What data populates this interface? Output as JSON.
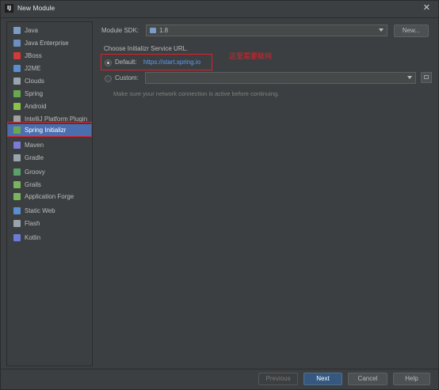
{
  "window": {
    "title": "New Module",
    "close_glyph": "✕"
  },
  "sidebar": {
    "items": [
      {
        "label": "Java",
        "icon": "folder-icon",
        "color": "#7a9cc6"
      },
      {
        "label": "Java Enterprise",
        "icon": "java-ee-icon",
        "color": "#6a8fc0"
      },
      {
        "label": "JBoss",
        "icon": "jboss-icon",
        "color": "#d33a3a"
      },
      {
        "label": "J2ME",
        "icon": "j2me-icon",
        "color": "#5a8ed0"
      },
      {
        "label": "Clouds",
        "icon": "clouds-icon",
        "color": "#9aa4ad"
      },
      {
        "label": "Spring",
        "icon": "spring-icon",
        "color": "#6aa84f"
      },
      {
        "label": "Android",
        "icon": "android-icon",
        "color": "#8bc34a"
      },
      {
        "label": "IntelliJ Platform Plugin",
        "icon": "plugin-icon",
        "color": "#a0a0a0"
      },
      {
        "label": "Spring Initializr",
        "icon": "spring-initializr-icon",
        "color": "#6aa84f",
        "selected": true
      },
      {
        "label": "Maven",
        "icon": "maven-icon",
        "color": "#7c7cd6"
      },
      {
        "label": "Gradle",
        "icon": "gradle-icon",
        "color": "#9aa4ad"
      },
      {
        "label": "Groovy",
        "icon": "groovy-icon",
        "color": "#5aa06a"
      },
      {
        "label": "Grails",
        "icon": "grails-icon",
        "color": "#7ab55c"
      },
      {
        "label": "Application Forge",
        "icon": "application-forge-icon",
        "color": "#7ab55c"
      },
      {
        "label": "Static Web",
        "icon": "static-web-icon",
        "color": "#5a8ed0"
      },
      {
        "label": "Flash",
        "icon": "flash-icon",
        "color": "#9aa4ad"
      },
      {
        "label": "Kotlin",
        "icon": "kotlin-icon",
        "color": "#6b7bd6"
      }
    ]
  },
  "main": {
    "module_sdk_label": "Module SDK:",
    "module_sdk_value": "1.8",
    "new_button": "New...",
    "service_url_heading": "Choose Initializr Service URL.",
    "default_label": "Default:",
    "default_url": "https://start.spring.io",
    "custom_label": "Custom:",
    "custom_value": "",
    "hint": "Make sure your network connection is active before continuing.",
    "annotation": "这里需要联网"
  },
  "footer": {
    "previous": "Previous",
    "next": "Next",
    "cancel": "Cancel",
    "help": "Help"
  },
  "colors": {
    "accent": "#4b6eaf",
    "link": "#589df6",
    "annotation": "#e0202b"
  }
}
